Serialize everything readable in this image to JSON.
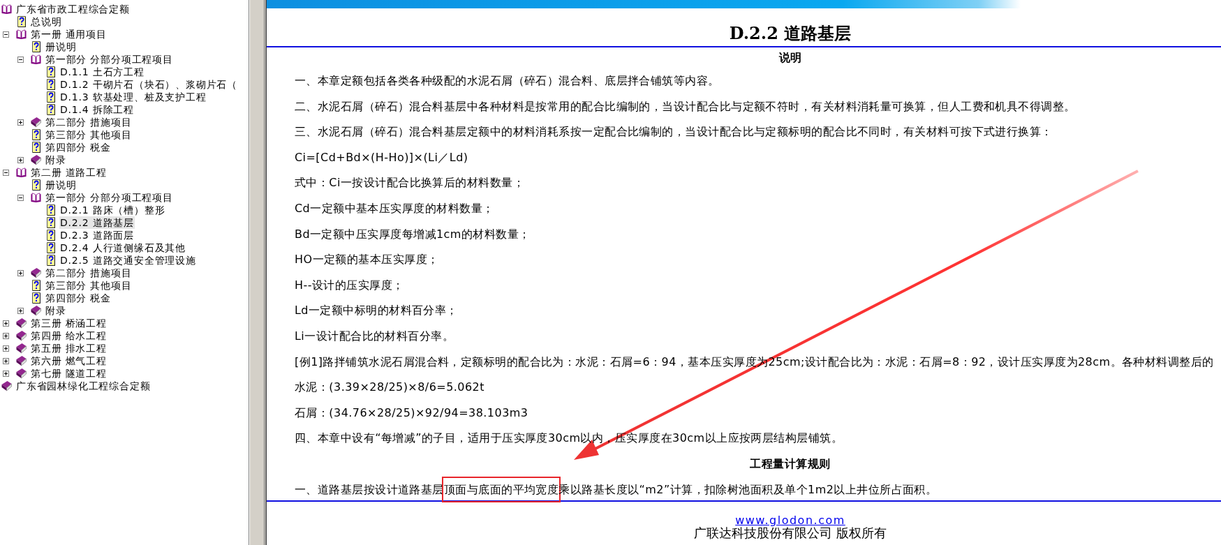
{
  "tree": [
    {
      "label": "广东省市政工程综合定额",
      "kind": "book",
      "expanded": true,
      "selected": false,
      "children": [
        {
          "label": "总说明",
          "kind": "doc",
          "selected": false
        },
        {
          "label": "第一册 通用项目",
          "kind": "book",
          "expanded": true,
          "selected": false,
          "children": [
            {
              "label": "册说明",
              "kind": "doc",
              "selected": false
            },
            {
              "label": "第一部分 分部分项工程项目",
              "kind": "book",
              "expanded": true,
              "selected": false,
              "children": [
                {
                  "label": "D.1.1 土石方工程",
                  "kind": "doc",
                  "selected": false
                },
                {
                  "label": "D.1.2 干砌片石（块石）、浆砌片石（",
                  "kind": "doc",
                  "selected": false
                },
                {
                  "label": "D.1.3 软基处理、桩及支护工程",
                  "kind": "doc",
                  "selected": false
                },
                {
                  "label": "D.1.4 拆除工程",
                  "kind": "doc",
                  "selected": false
                }
              ]
            },
            {
              "label": "第二部分 措施项目",
              "kind": "book",
              "expanded": false,
              "selected": false
            },
            {
              "label": "第三部分 其他项目",
              "kind": "doc",
              "selected": false
            },
            {
              "label": "第四部分 税金",
              "kind": "doc",
              "selected": false
            },
            {
              "label": "附录",
              "kind": "book",
              "expanded": false,
              "selected": false
            }
          ]
        },
        {
          "label": "第二册 道路工程",
          "kind": "book",
          "expanded": true,
          "selected": false,
          "children": [
            {
              "label": "册说明",
              "kind": "doc",
              "selected": false
            },
            {
              "label": "第一部分 分部分项工程项目",
              "kind": "book",
              "expanded": true,
              "selected": false,
              "children": [
                {
                  "label": "D.2.1 路床（槽）整形",
                  "kind": "doc",
                  "selected": false
                },
                {
                  "label": "D.2.2 道路基层",
                  "kind": "doc",
                  "selected": true
                },
                {
                  "label": "D.2.3 道路面层",
                  "kind": "doc",
                  "selected": false
                },
                {
                  "label": "D.2.4 人行道侧缘石及其他",
                  "kind": "doc",
                  "selected": false
                },
                {
                  "label": "D.2.5 道路交通安全管理设施",
                  "kind": "doc",
                  "selected": false
                }
              ]
            },
            {
              "label": "第二部分 措施项目",
              "kind": "book",
              "expanded": false,
              "selected": false
            },
            {
              "label": "第三部分 其他项目",
              "kind": "doc",
              "selected": false
            },
            {
              "label": "第四部分 税金",
              "kind": "doc",
              "selected": false
            },
            {
              "label": "附录",
              "kind": "book",
              "expanded": false,
              "selected": false
            }
          ]
        },
        {
          "label": "第三册 桥涵工程",
          "kind": "book",
          "expanded": false,
          "selected": false
        },
        {
          "label": "第四册 给水工程",
          "kind": "book",
          "expanded": false,
          "selected": false
        },
        {
          "label": "第五册 排水工程",
          "kind": "book",
          "expanded": false,
          "selected": false
        },
        {
          "label": "第六册 燃气工程",
          "kind": "book",
          "expanded": false,
          "selected": false
        },
        {
          "label": "第七册 隧道工程",
          "kind": "book",
          "expanded": false,
          "selected": false
        }
      ]
    },
    {
      "label": "广东省园林绿化工程综合定额",
      "kind": "book",
      "expanded": false,
      "selected": false
    }
  ],
  "document": {
    "title": "D.2.2 道路基层",
    "lines": [
      {
        "kind": "heading",
        "text": "说明"
      },
      {
        "kind": "text",
        "text": "一、本章定额包括各类各种级配的水泥石屑（碎石）混合料、底层拌合铺筑等内容。"
      },
      {
        "kind": "text",
        "text": "二、水泥石屑（碎石）混合料基层中各种材料是按常用的配合比编制的，当设计配合比与定额不符时，有关材料消耗量可换算，但人工费和机具不得调整。"
      },
      {
        "kind": "text",
        "text": "三、水泥石屑（碎石）混合料基层定额中的材料消耗系按一定配合比编制的，当设计配合比与定额标明的配合比不同时，有关材料可按下式进行换算："
      },
      {
        "kind": "text",
        "text": "Ci=[Cd+Bd×(H-Ho)]×(Li／Ld)"
      },
      {
        "kind": "text",
        "text": "式中：Ci一按设计配合比换算后的材料数量；"
      },
      {
        "kind": "text",
        "text": "Cd一定额中基本压实厚度的材料数量；"
      },
      {
        "kind": "text",
        "text": "Bd一定额中压实厚度每增减1cm的材料数量；"
      },
      {
        "kind": "text",
        "text": "HO一定额的基本压实厚度；"
      },
      {
        "kind": "text",
        "text": "H--设计的压实厚度；"
      },
      {
        "kind": "text",
        "text": "Ld一定额中标明的材料百分率；"
      },
      {
        "kind": "text",
        "text": "Li一设计配合比的材料百分率。"
      },
      {
        "kind": "text",
        "text": "[例1]路拌铺筑水泥石屑混合料，定额标明的配合比为：水泥：石屑=6：94，基本压实厚度为25cm;设计配合比为：水泥：石屑=8：92，设计压实厚度为28cm。各种材料调整后的"
      },
      {
        "kind": "text",
        "text": "水泥：(3.39×28/25)×8/6=5.062t"
      },
      {
        "kind": "text",
        "text": "石屑：(34.76×28/25)×92/94=38.103m3"
      },
      {
        "kind": "text",
        "text": "四、本章中设有“每增减”的子目，适用于压实厚度30cm以内，压实厚度在30cm以上应按两层结构层铺筑。"
      },
      {
        "kind": "heading",
        "text": "工程量计算规则"
      },
      {
        "kind": "annotated",
        "before": "一、道路基层按设计道路基层",
        "highlighted": "顶面与底面的平均宽度",
        "after": "乘以路基长度以“m2”计算，扣除树池面积及单个1m2以上井位所占面积。"
      }
    ],
    "footer_link": "www.glodon.com",
    "copyright": "广联达科技股份有限公司 版权所有"
  }
}
